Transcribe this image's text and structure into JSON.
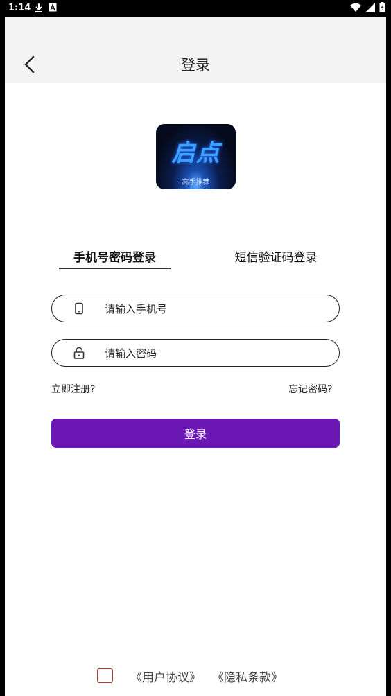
{
  "status_bar": {
    "time": "1:14",
    "icons": [
      "download-icon",
      "a-icon",
      "wifi-icon",
      "signal-icon",
      "battery-icon"
    ]
  },
  "header": {
    "title": "登录",
    "back_icon": "chevron-left-icon"
  },
  "logo": {
    "brand": "启点",
    "tagline": "高手推荐"
  },
  "tabs": [
    {
      "label": "手机号密码登录",
      "active": true
    },
    {
      "label": "短信验证码登录",
      "active": false
    }
  ],
  "form": {
    "phone": {
      "placeholder": "请输入手机号",
      "value": "",
      "icon": "phone-icon"
    },
    "password": {
      "placeholder": "请输入密码",
      "value": "",
      "icon": "lock-icon"
    },
    "register_link": "立即注册?",
    "forgot_link": "忘记密码?",
    "submit_label": "登录"
  },
  "agreement": {
    "checked": false,
    "user_agreement": "《用户协议》",
    "privacy_policy": "《隐私条款》"
  },
  "colors": {
    "accent": "#6a17b3",
    "checkbox_border": "#c0392b",
    "header_bg": "#f3f3f3"
  }
}
